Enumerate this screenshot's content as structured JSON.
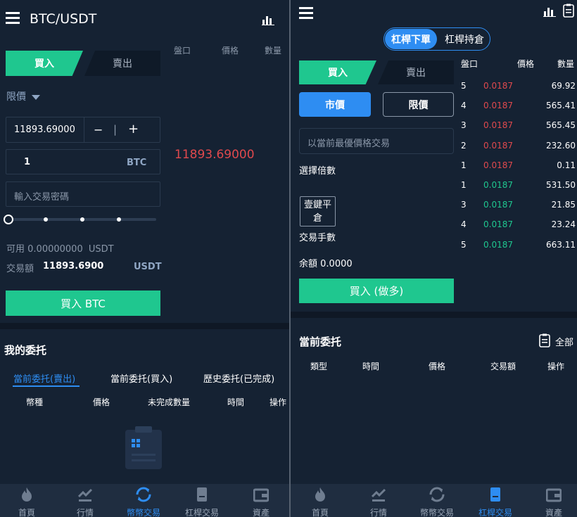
{
  "left": {
    "title": "BTC/USDT",
    "tabs": {
      "buy": "買入",
      "sell": "賣出"
    },
    "orderbook_headers": [
      "盤口",
      "價格",
      "數量"
    ],
    "order_type": "限價",
    "price_value": "11893.69000",
    "stepper_minus": "−",
    "stepper_sep": "|",
    "stepper_plus": "+",
    "amount_value": "1",
    "amount_unit": "BTC",
    "password_placeholder": "輸入交易密碼",
    "last_price": "11893.69000",
    "available_label": "可用",
    "available_value": "0.00000000",
    "available_unit": "USDT",
    "trade_amount_label": "交易額",
    "trade_amount_value": "11893.6900",
    "trade_amount_unit": "USDT",
    "buy_button": "買入 BTC",
    "orders_title": "我的委托",
    "order_tabs": [
      "當前委托(賣出)",
      "當前委托(買入)",
      "歷史委托(已完成)"
    ],
    "order_columns": [
      "幣種",
      "價格",
      "未完成數量",
      "時間",
      "操作"
    ],
    "slider_fraction": 0
  },
  "right": {
    "toggle": {
      "active": "杠桿下單",
      "inactive": "杠桿持倉"
    },
    "tabs": {
      "buy": "買入",
      "sell": "賣出"
    },
    "order_types": {
      "market": "市價",
      "limit": "限價"
    },
    "price_placeholder": "以當前最優價格交易",
    "leverage_label": "選擇倍數",
    "one_click_close": "壹鍵平倉",
    "lots_label": "交易手數",
    "balance_label": "余額",
    "balance_value": "0.0000",
    "buy_button": "買入 (做多)",
    "orderbook_headers": [
      "盤口",
      "價格",
      "數量"
    ],
    "asks": [
      {
        "level": "5",
        "price": "0.0187",
        "qty": "69.92"
      },
      {
        "level": "4",
        "price": "0.0187",
        "qty": "565.41"
      },
      {
        "level": "3",
        "price": "0.0187",
        "qty": "565.45"
      },
      {
        "level": "2",
        "price": "0.0187",
        "qty": "232.60"
      },
      {
        "level": "1",
        "price": "0.0187",
        "qty": "0.11"
      }
    ],
    "bids": [
      {
        "level": "1",
        "price": "0.0187",
        "qty": "531.50"
      },
      {
        "level": "3",
        "price": "0.0187",
        "qty": "21.85"
      },
      {
        "level": "4",
        "price": "0.0187",
        "qty": "23.24"
      },
      {
        "level": "5",
        "price": "0.0187",
        "qty": "663.11"
      }
    ],
    "orders_title": "當前委托",
    "all_label": "全部",
    "order_columns": [
      "類型",
      "時間",
      "價格",
      "交易額",
      "操作"
    ]
  },
  "nav": {
    "left_items": [
      {
        "label": "首頁",
        "icon": "fire-icon"
      },
      {
        "label": "行情",
        "icon": "market-icon"
      },
      {
        "label": "幣幣交易",
        "icon": "swap-icon"
      },
      {
        "label": "杠桿交易",
        "icon": "leverage-icon"
      },
      {
        "label": "資產",
        "icon": "wallet-icon"
      }
    ],
    "right_items": [
      {
        "label": "首頁",
        "icon": "fire-icon"
      },
      {
        "label": "行情",
        "icon": "market-icon"
      },
      {
        "label": "幣幣交易",
        "icon": "swap-icon"
      },
      {
        "label": "杠桿交易",
        "icon": "leverage-icon"
      },
      {
        "label": "資產",
        "icon": "wallet-icon"
      }
    ],
    "left_active": 2,
    "right_active": 3
  },
  "colors": {
    "green": "#1fc78f",
    "red": "#e0494d",
    "blue": "#2e8df2",
    "bg": "#152233"
  }
}
